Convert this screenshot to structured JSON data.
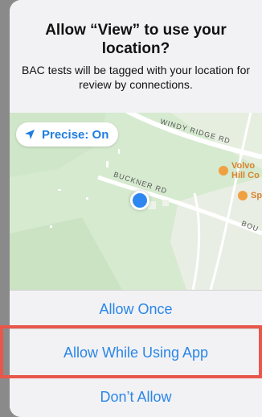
{
  "dialog": {
    "title": "Allow “View” to use your location?",
    "message": "BAC tests will be tagged with your location for review by connections."
  },
  "map": {
    "precise_label": "Precise: On",
    "precise_icon": "location-arrow-icon",
    "roads": {
      "windy_ridge": "WINDY RIDGE RD",
      "buckner": "BUCKNER RD",
      "bou": "BOU"
    },
    "poi": {
      "volvo": "Volvo",
      "hill": "Hill Co",
      "sp": "Sp"
    }
  },
  "actions": {
    "allow_once": "Allow Once",
    "allow_while_using": "Allow While Using App",
    "dont_allow": "Don’t Allow"
  },
  "colors": {
    "accent": "#2a86e8",
    "highlight": "#e8574a",
    "map_green": "#d6ead0"
  }
}
